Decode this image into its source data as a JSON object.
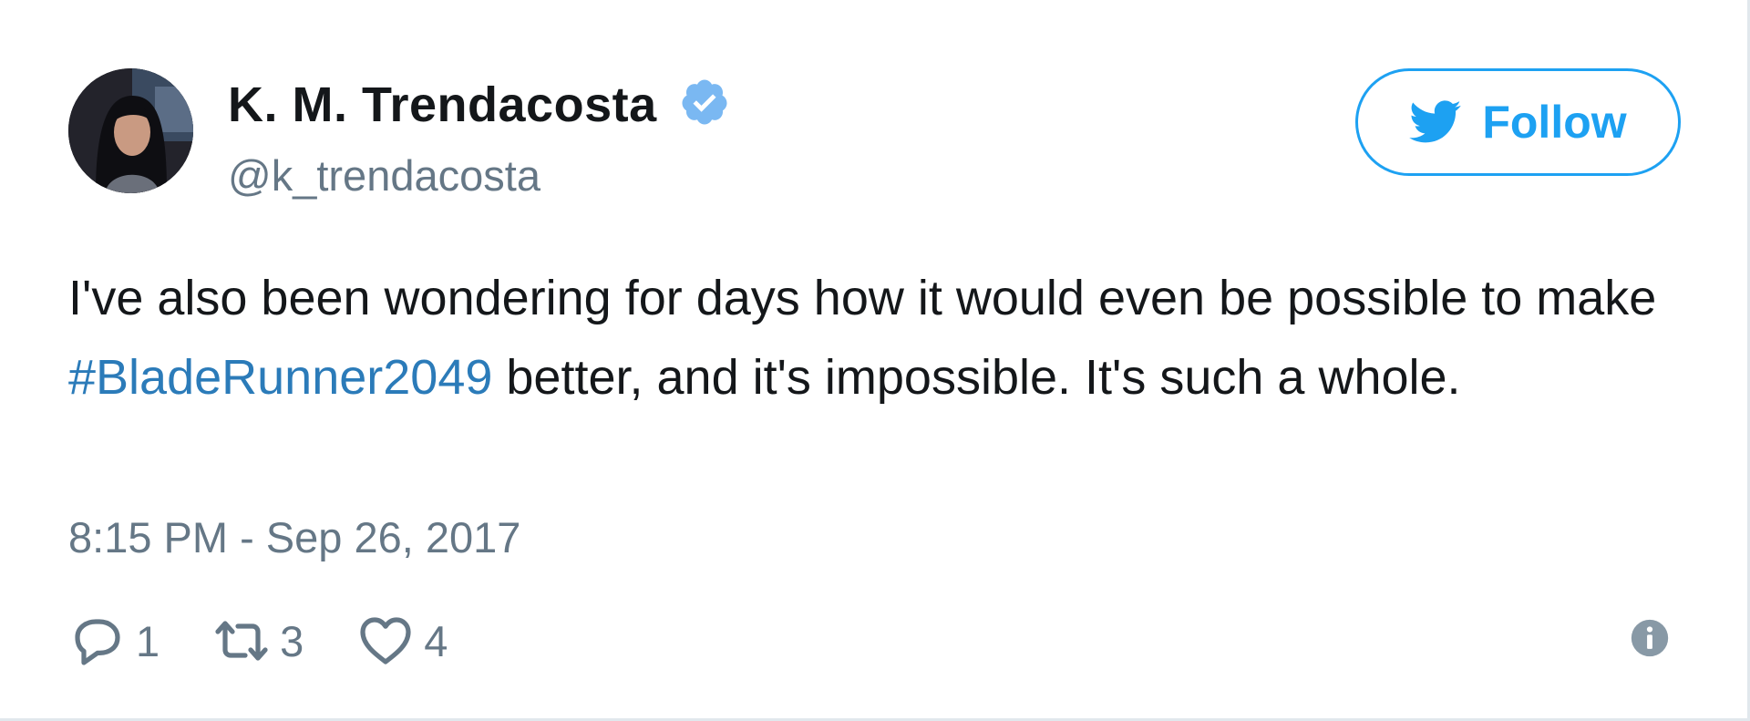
{
  "author": {
    "display_name": "K. M. Trendacosta",
    "handle": "@k_trendacosta",
    "verified": true,
    "avatar_icon": "profile-photo"
  },
  "follow_button": {
    "label": "Follow",
    "icon": "twitter-bird-icon"
  },
  "tweet": {
    "text_before": "I've also been wondering for days how it would even be possible to make ",
    "hashtag": "#BladeRunner2049",
    "text_after": " better, and it's impossible. It's such a whole.",
    "timestamp": "8:15 PM - Sep 26, 2017"
  },
  "actions": {
    "reply": {
      "icon": "reply-icon",
      "count": "1"
    },
    "retweet": {
      "icon": "retweet-icon",
      "count": "3"
    },
    "like": {
      "icon": "heart-icon",
      "count": "4"
    },
    "info": {
      "icon": "info-icon"
    }
  },
  "colors": {
    "brand_blue": "#1da1f2",
    "link_blue": "#2b7bb9",
    "text_primary": "#14171a",
    "text_secondary": "#657786",
    "verified_blue": "#7ab8f2"
  }
}
